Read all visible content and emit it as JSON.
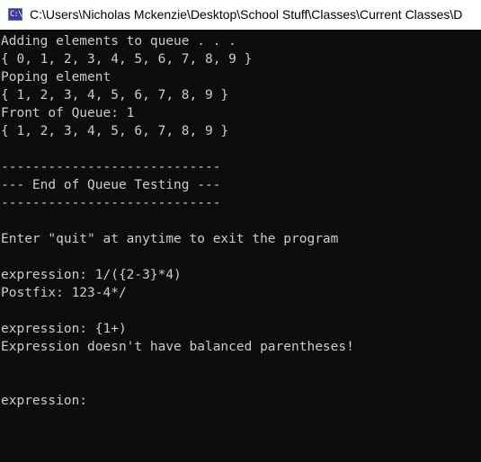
{
  "window": {
    "title": "C:\\Users\\Nicholas Mckenzie\\Desktop\\School Stuff\\Classes\\Current Classes\\D",
    "icon": "console-app-icon",
    "icon_glyph": "C:\\"
  },
  "console": {
    "lines": [
      "Adding elements to queue . . .",
      "{ 0, 1, 2, 3, 4, 5, 6, 7, 8, 9 }",
      "Poping element",
      "{ 1, 2, 3, 4, 5, 6, 7, 8, 9 }",
      "Front of Queue: 1",
      "{ 1, 2, 3, 4, 5, 6, 7, 8, 9 }",
      "",
      "----------------------------",
      "--- End of Queue Testing ---",
      "----------------------------",
      "",
      "Enter \"quit\" at anytime to exit the program",
      "",
      "expression: 1/({2-3}*4)",
      "Postfix: 123-4*/",
      "",
      "expression: {1+)",
      "Expression doesn't have balanced parentheses!",
      "",
      "",
      "expression: "
    ]
  },
  "colors": {
    "background": "#0c0c0c",
    "text": "#cccccc",
    "titlebar": "#ffffff"
  }
}
